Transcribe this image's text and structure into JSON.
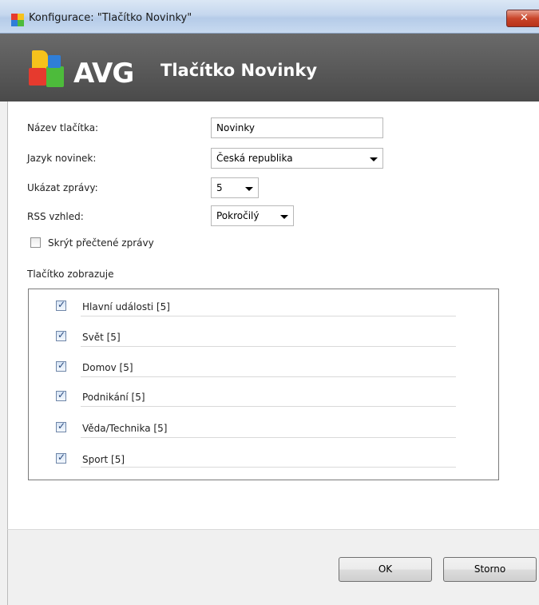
{
  "window": {
    "title": "Konfigurace: \"Tlačítko Novinky\"",
    "close_label": "✕"
  },
  "banner": {
    "brand": "AVG",
    "title": "Tlačítko Novinky"
  },
  "form": {
    "button_name_label": "Název tlačítka:",
    "button_name_value": "Novinky",
    "language_label": "Jazyk novinek:",
    "language_value": "Česká republika",
    "show_news_label": "Ukázat zprávy:",
    "show_news_value": "5",
    "rss_label": "RSS vzhled:",
    "rss_value": "Pokročilý",
    "hide_read_label": "Skrýt přečtené zprávy",
    "hide_read_checked": false
  },
  "group": {
    "label": "Tlačítko zobrazuje",
    "items": [
      {
        "label": "Hlavní události [5]",
        "checked": true
      },
      {
        "label": "Svět [5]",
        "checked": true
      },
      {
        "label": "Domov [5]",
        "checked": true
      },
      {
        "label": "Podnikání [5]",
        "checked": true
      },
      {
        "label": "Věda/Technika [5]",
        "checked": true
      },
      {
        "label": "Sport [5]",
        "checked": true
      }
    ]
  },
  "buttons": {
    "ok": "OK",
    "cancel": "Storno"
  }
}
